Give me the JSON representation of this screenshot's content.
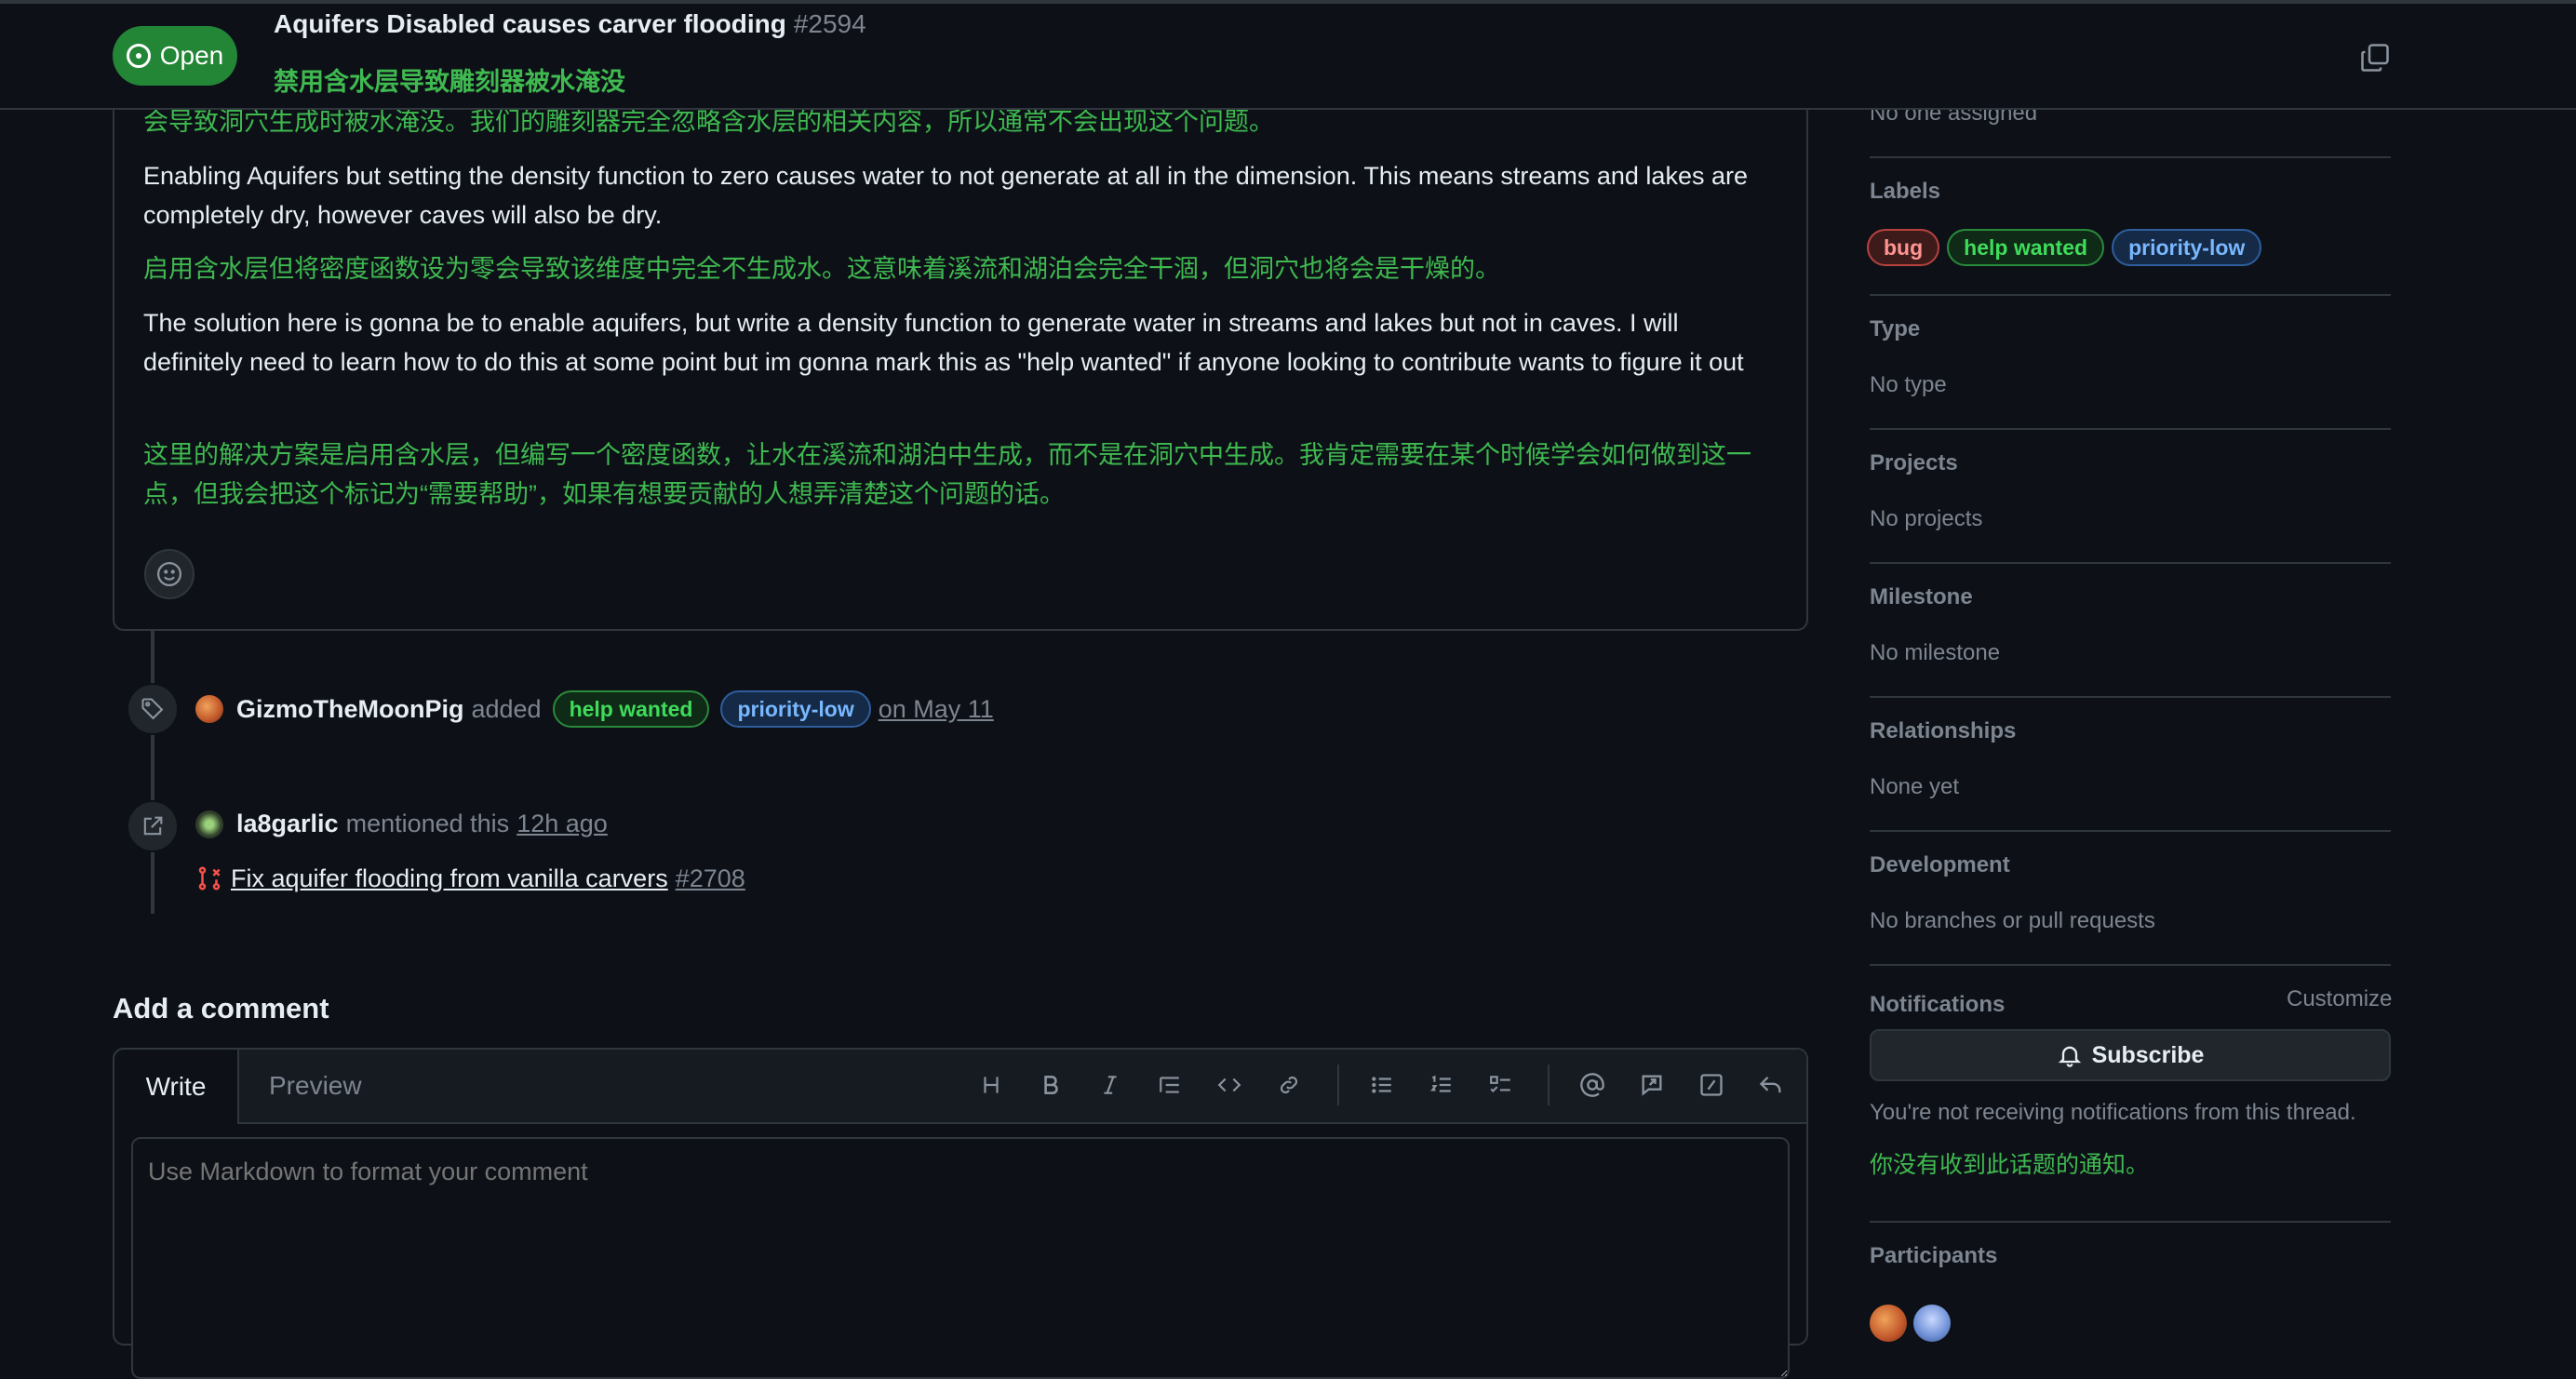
{
  "header": {
    "state": "Open",
    "title": "Aquifers Disabled causes carver flooding",
    "number": "#2594",
    "title_translation": "禁用含水层导致雕刻器被水淹没"
  },
  "comment": {
    "paragraphs": [
      {
        "lang": "zh",
        "text": "会导致洞穴生成时被水淹没。我们的雕刻器完全忽略含水层的相关内容，所以通常不会出现这个问题。"
      },
      {
        "lang": "en",
        "text": "Enabling Aquifers but setting the density function to zero causes water to not generate at all in the dimension. This means streams and lakes are completely dry, however caves will also be dry."
      },
      {
        "lang": "zh",
        "text": "启用含水层但将密度函数设为零会导致该维度中完全不生成水。这意味着溪流和湖泊会完全干涸，但洞穴也将会是干燥的。"
      },
      {
        "lang": "en",
        "text": "The solution here is gonna be to enable aquifers, but write a density function to generate water in streams and lakes but not in caves. I will definitely need to learn how to do this at some point but im gonna mark this as \"help wanted\" if anyone looking to contribute wants to figure it out"
      },
      {
        "lang": "zh",
        "text": "这里的解决方案是启用含水层，但编写一个密度函数，让水在溪流和湖泊中生成，而不是在洞穴中生成。我肯定需要在某个时候学会如何做到这一点，但我会把这个标记为“需要帮助”，如果有想要贡献的人想弄清楚这个问题的话。"
      }
    ]
  },
  "timeline": {
    "label_event": {
      "user": "GizmoTheMoonPig",
      "action": "added",
      "labels": [
        "help wanted",
        "priority-low"
      ],
      "date": "on May 11"
    },
    "mention_event": {
      "user": "la8garlic",
      "action": "mentioned this",
      "time": "12h ago",
      "pr_title": "Fix aquifer flooding from vanilla carvers",
      "pr_number": "#2708"
    }
  },
  "editor": {
    "heading": "Add a comment",
    "tab_write": "Write",
    "tab_preview": "Preview",
    "placeholder": "Use Markdown to format your comment"
  },
  "sidebar": {
    "assignees_value": "No one assigned",
    "labels_title": "Labels",
    "labels": [
      "bug",
      "help wanted",
      "priority-low"
    ],
    "type_title": "Type",
    "type_value": "No type",
    "projects_title": "Projects",
    "projects_value": "No projects",
    "milestone_title": "Milestone",
    "milestone_value": "No milestone",
    "relationships_title": "Relationships",
    "relationships_value": "None yet",
    "development_title": "Development",
    "development_value": "No branches or pull requests",
    "notifications_title": "Notifications",
    "customize": "Customize",
    "subscribe": "Subscribe",
    "notif_text": "You're not receiving notifications from this thread.",
    "notif_text_translation": "你没有收到此话题的通知。",
    "participants_title": "Participants"
  },
  "colors": {
    "background": "#0d1117",
    "open_green": "#238636",
    "translation_green": "#3fb950",
    "border": "#30363d"
  }
}
